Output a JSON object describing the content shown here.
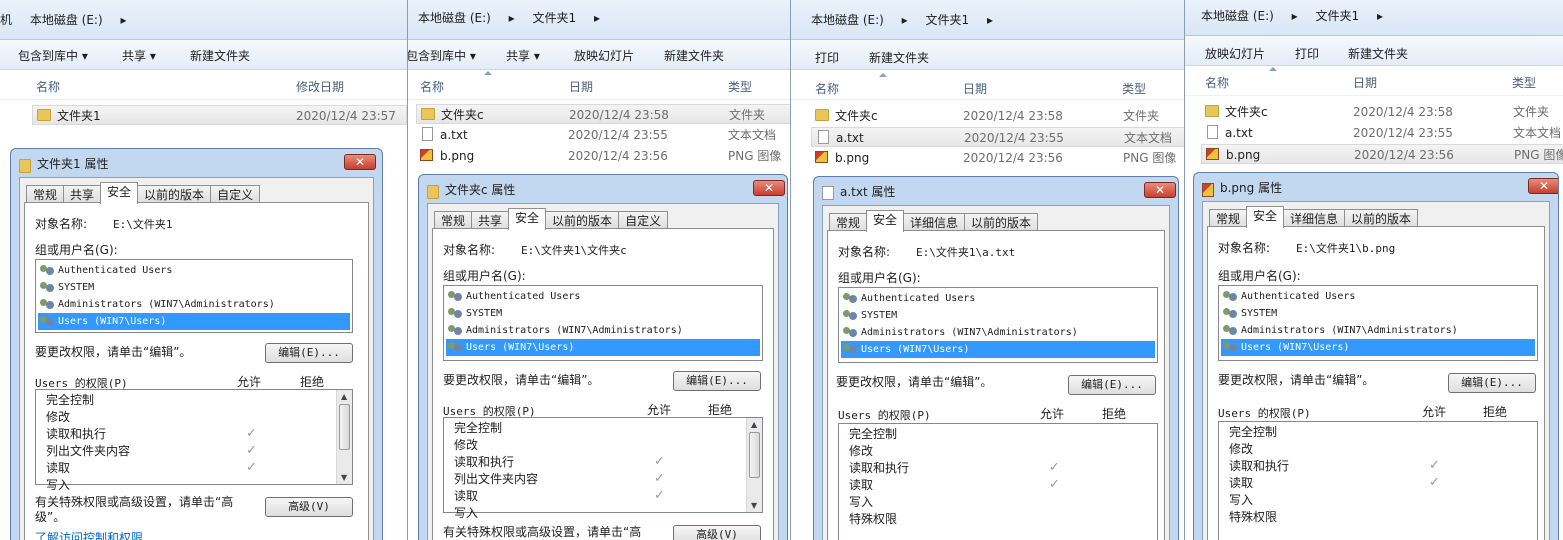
{
  "panels": [
    {
      "crumbs": [
        "机",
        "本地磁盘 (E:)",
        "▸"
      ],
      "toolbar": [
        "包含到库中 ▾",
        "共享 ▾",
        "新建文件夹"
      ],
      "cols": [
        "名称",
        "修改日期"
      ],
      "files": [
        {
          "name": "文件夹1",
          "date": "2020/12/4 23:57",
          "type": ""
        }
      ],
      "dialog": {
        "title": "文件夹1 属性",
        "tabs": [
          "常规",
          "共享",
          "安全",
          "以前的版本",
          "自定义"
        ],
        "object_label": "对象名称:",
        "object_value": "E:\\文件夹1",
        "group_label": "组或用户名(G):",
        "users": [
          "Authenticated Users",
          "SYSTEM",
          "Administrators (WIN7\\Administrators)",
          "Users (WIN7\\Users)"
        ],
        "edit_hint": "要更改权限，请单击“编辑”。",
        "edit_button": "编辑(E)...",
        "perm_label": "Users 的权限(P)",
        "allow": "允许",
        "deny": "拒绝",
        "perms": [
          "完全控制",
          "修改",
          "读取和执行",
          "列出文件夹内容",
          "读取",
          "写入"
        ],
        "advanced_hint": "有关特殊权限或高级设置，请单击“高级”。",
        "advanced_button": "高级(V)",
        "link": "了解访问控制和权限"
      }
    },
    {
      "crumbs": [
        "本地磁盘 (E:)",
        "▸",
        "文件夹1",
        "▸"
      ],
      "toolbar": [
        "包含到库中 ▾",
        "共享 ▾",
        "放映幻灯片",
        "新建文件夹"
      ],
      "cols": [
        "名称",
        "日期",
        "类型"
      ],
      "files": [
        {
          "name": "文件夹c",
          "date": "2020/12/4 23:58",
          "type": "文件夹"
        },
        {
          "name": "a.txt",
          "date": "2020/12/4 23:55",
          "type": "文本文档"
        },
        {
          "name": "b.png",
          "date": "2020/12/4 23:56",
          "type": "PNG 图像"
        }
      ],
      "dialog": {
        "title": "文件夹c 属性",
        "tabs": [
          "常规",
          "共享",
          "安全",
          "以前的版本",
          "自定义"
        ],
        "object_label": "对象名称:",
        "object_value": "E:\\文件夹1\\文件夹c",
        "group_label": "组或用户名(G):",
        "users": [
          "Authenticated Users",
          "SYSTEM",
          "Administrators (WIN7\\Administrators)",
          "Users (WIN7\\Users)"
        ],
        "edit_hint": "要更改权限，请单击“编辑”。",
        "edit_button": "编辑(E)...",
        "perm_label": "Users 的权限(P)",
        "allow": "允许",
        "deny": "拒绝",
        "perms": [
          "完全控制",
          "修改",
          "读取和执行",
          "列出文件夹内容",
          "读取",
          "写入"
        ],
        "advanced_hint": "有关特殊权限或高级设置，请单击“高",
        "advanced_button": "高级(V)"
      }
    },
    {
      "crumbs": [
        "本地磁盘 (E:)",
        "▸",
        "文件夹1",
        "▸"
      ],
      "toolbar": [
        "打印",
        "新建文件夹"
      ],
      "cols": [
        "名称",
        "日期",
        "类型"
      ],
      "files": [
        {
          "name": "文件夹c",
          "date": "2020/12/4 23:58",
          "type": "文件夹"
        },
        {
          "name": "a.txt",
          "date": "2020/12/4 23:55",
          "type": "文本文档"
        },
        {
          "name": "b.png",
          "date": "2020/12/4 23:56",
          "type": "PNG 图像"
        }
      ],
      "dialog": {
        "title": "a.txt 属性",
        "tabs": [
          "常规",
          "安全",
          "详细信息",
          "以前的版本"
        ],
        "object_label": "对象名称:",
        "object_value": "E:\\文件夹1\\a.txt",
        "group_label": "组或用户名(G):",
        "users": [
          "Authenticated Users",
          "SYSTEM",
          "Administrators (WIN7\\Administrators)",
          "Users (WIN7\\Users)"
        ],
        "edit_hint": "要更改权限，请单击“编辑”。",
        "edit_button": "编辑(E)...",
        "perm_label": "Users 的权限(P)",
        "allow": "允许",
        "deny": "拒绝",
        "perms": [
          "完全控制",
          "修改",
          "读取和执行",
          "读取",
          "写入",
          "特殊权限"
        ]
      }
    },
    {
      "crumbs": [
        "本地磁盘 (E:)",
        "▸",
        "文件夹1",
        "▸"
      ],
      "toolbar": [
        "放映幻灯片",
        "打印",
        "新建文件夹"
      ],
      "cols": [
        "名称",
        "日期",
        "类型"
      ],
      "files": [
        {
          "name": "文件夹c",
          "date": "2020/12/4 23:58",
          "type": "文件夹"
        },
        {
          "name": "a.txt",
          "date": "2020/12/4 23:55",
          "type": "文本文档"
        },
        {
          "name": "b.png",
          "date": "2020/12/4 23:56",
          "type": "PNG 图像"
        }
      ],
      "dialog": {
        "title": "b.png 属性",
        "tabs": [
          "常规",
          "安全",
          "详细信息",
          "以前的版本"
        ],
        "object_label": "对象名称:",
        "object_value": "E:\\文件夹1\\b.png",
        "group_label": "组或用户名(G):",
        "users": [
          "Authenticated Users",
          "SYSTEM",
          "Administrators (WIN7\\Administrators)",
          "Users (WIN7\\Users)"
        ],
        "edit_hint": "要更改权限，请单击“编辑”。",
        "edit_button": "编辑(E)...",
        "perm_label": "Users 的权限(P)",
        "allow": "允许",
        "deny": "拒绝",
        "perms": [
          "完全控制",
          "修改",
          "读取和执行",
          "读取",
          "写入",
          "特殊权限"
        ]
      }
    }
  ]
}
